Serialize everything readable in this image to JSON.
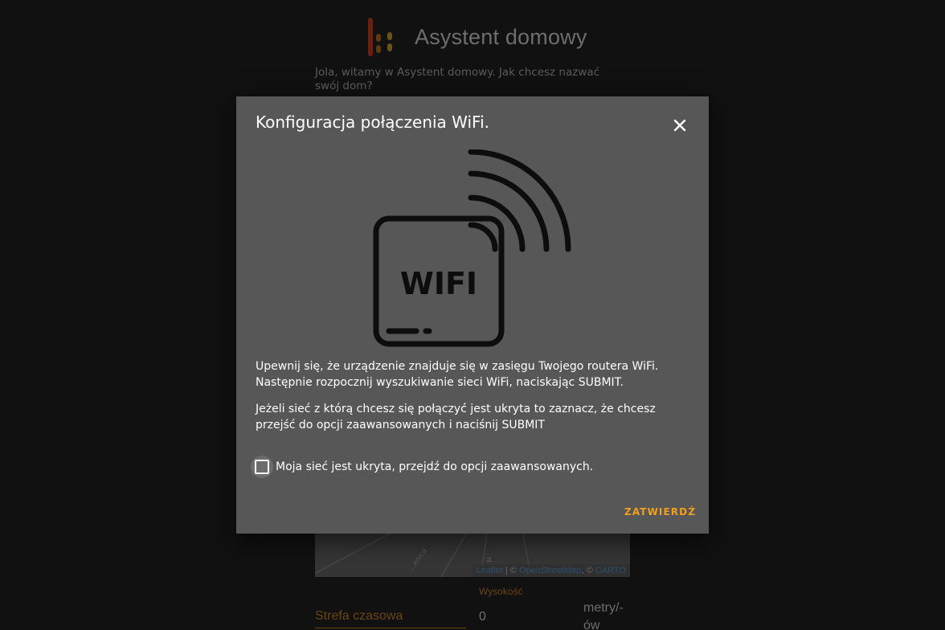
{
  "app": {
    "title": "Asystent domowy"
  },
  "onboarding": {
    "welcome_text": "Jola, witamy w Asystent domowy. Jak chcesz nazwać swój dom?",
    "map": {
      "attribution_leaflet": "Leaflet",
      "attribution_sep1": " | © ",
      "attribution_osm": "OpenStreetMap",
      "attribution_sep2": ", © ",
      "attribution_carto": "CARTO",
      "street_label_1": "...enica",
      "street_label_2": "N"
    },
    "timezone_label": "Strefa czasowa",
    "elevation": {
      "label": "Wysokość",
      "value": "0",
      "unit": "metry/-ów"
    }
  },
  "dialog": {
    "title": "Konfiguracja połączenia WiFi.",
    "illustration": {
      "icon": "wifi-router-icon",
      "text": "WIFI"
    },
    "description_1": "Upewnij się, że urządzenie znajduje się w zasięgu Twojego routera WiFi. Następnie rozpocznij wyszukiwanie sieci WiFi, naciskając SUBMIT.",
    "description_2": "Jeżeli sieć z którą chcesz się połączyć jest ukryta to zaznacz, że chcesz przejść do opcji zaawansowanych i naciśnij SUBMIT",
    "hidden_network_checkbox": {
      "label": "Moja sieć jest ukryta, przejdź do opcji zaawansowanych.",
      "checked": false
    },
    "submit_label": "ZATWIERDŹ",
    "close_icon": "close-icon"
  },
  "colors": {
    "background": "#111111",
    "dialog_surface": "#575757",
    "accent": "#f0a020",
    "muted_accent": "#6a4413"
  }
}
